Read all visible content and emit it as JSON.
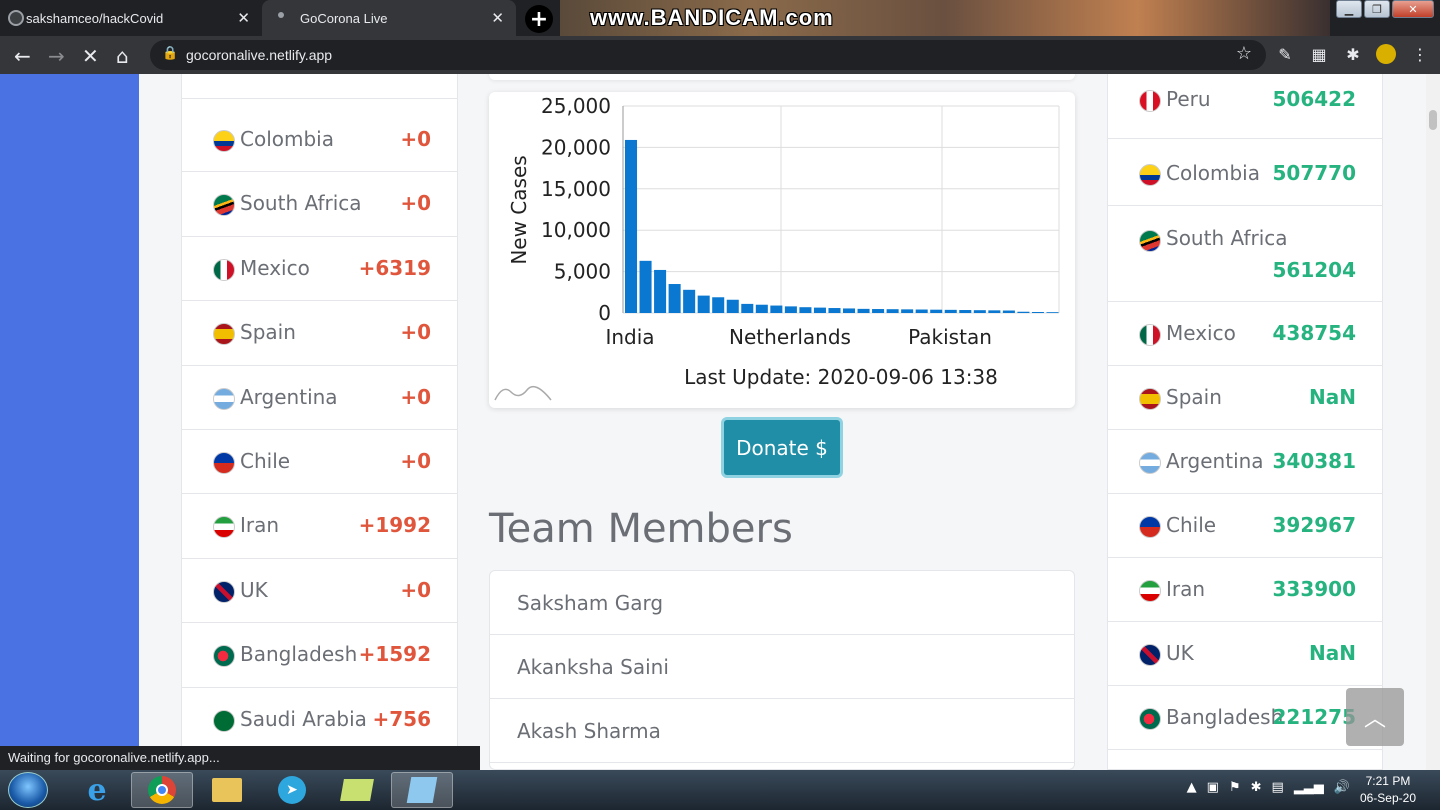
{
  "browser": {
    "tabs": [
      {
        "title": "sakshamceo/hackCovid",
        "active": false
      },
      {
        "title": "GoCorona Live",
        "active": true
      }
    ],
    "url": "gocoronalive.netlify.app",
    "watermark": "www.BANDICAM.com",
    "status": "Waiting for gocoronalive.netlify.app..."
  },
  "left_list": [
    {
      "country": "Colombia",
      "value": "+0",
      "flag": "co"
    },
    {
      "country": "South Africa",
      "value": "+0",
      "flag": "za"
    },
    {
      "country": "Mexico",
      "value": "+6319",
      "flag": "mx"
    },
    {
      "country": "Spain",
      "value": "+0",
      "flag": "es"
    },
    {
      "country": "Argentina",
      "value": "+0",
      "flag": "ar"
    },
    {
      "country": "Chile",
      "value": "+0",
      "flag": "cl"
    },
    {
      "country": "Iran",
      "value": "+1992",
      "flag": "ir"
    },
    {
      "country": "UK",
      "value": "+0",
      "flag": "gb"
    },
    {
      "country": "Bangladesh",
      "value": "+1592",
      "flag": "bd"
    },
    {
      "country": "Saudi Arabia",
      "value": "+756",
      "flag": "sa"
    }
  ],
  "right_list": [
    {
      "country": "Peru",
      "value": "506422",
      "flag": "pe"
    },
    {
      "country": "Colombia",
      "value": "507770",
      "flag": "co"
    },
    {
      "country": "South Africa",
      "value": "561204",
      "flag": "za"
    },
    {
      "country": "Mexico",
      "value": "438754",
      "flag": "mx"
    },
    {
      "country": "Spain",
      "value": "NaN",
      "flag": "es"
    },
    {
      "country": "Argentina",
      "value": "340381",
      "flag": "ar"
    },
    {
      "country": "Chile",
      "value": "392967",
      "flag": "cl"
    },
    {
      "country": "Iran",
      "value": "333900",
      "flag": "ir"
    },
    {
      "country": "UK",
      "value": "NaN",
      "flag": "gb"
    },
    {
      "country": "Bangladesh",
      "value": "221275",
      "flag": "bd"
    }
  ],
  "chart_data": {
    "type": "bar",
    "ylabel": "New Cases",
    "ylim": [
      0,
      25000
    ],
    "y_ticks": [
      "25,000",
      "20,000",
      "15,000",
      "10,000",
      "5,000",
      "0"
    ],
    "x_tick_labels": [
      "India",
      "Netherlands",
      "Pakistan"
    ],
    "values": [
      20900,
      6300,
      5200,
      3500,
      2800,
      2100,
      1900,
      1600,
      1100,
      1000,
      900,
      800,
      700,
      650,
      600,
      550,
      500,
      480,
      460,
      440,
      420,
      400,
      380,
      360,
      340,
      320,
      300,
      150,
      120,
      100
    ],
    "grid": true,
    "footer": "Last Update: 2020-09-06 13:38"
  },
  "donate_label": "Donate $",
  "team": {
    "title": "Team Members",
    "members": [
      "Saksham Garg",
      "Akanksha Saini",
      "Akash Sharma"
    ]
  },
  "back_to_top": "^",
  "taskbar": {
    "time": "7:21 PM",
    "date": "06-Sep-20"
  }
}
